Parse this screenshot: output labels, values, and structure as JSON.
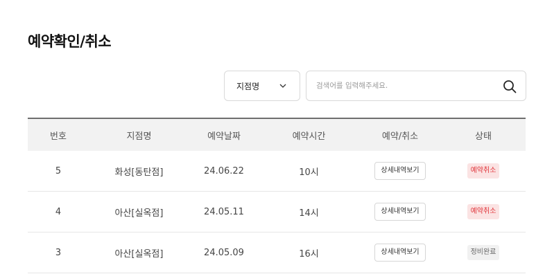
{
  "page": {
    "title": "예약확인/취소"
  },
  "filter": {
    "branch_select_value": "지점명",
    "search_placeholder": "검색어를 입력해주세요."
  },
  "table": {
    "headers": [
      "번호",
      "지점명",
      "예약날짜",
      "예약시간",
      "예약/취소",
      "상태"
    ],
    "rows": [
      {
        "no": "5",
        "branch": "화성[동탄점]",
        "date": "24.06.22",
        "time": "10시",
        "action": "상세내역보기",
        "status": "예약취소",
        "status_type": "cancel"
      },
      {
        "no": "4",
        "branch": "아산[실옥점]",
        "date": "24.05.11",
        "time": "14시",
        "action": "상세내역보기",
        "status": "예약취소",
        "status_type": "cancel"
      },
      {
        "no": "3",
        "branch": "아산[실옥점]",
        "date": "24.05.09",
        "time": "16시",
        "action": "상세내역보기",
        "status": "정비완료",
        "status_type": "done"
      }
    ]
  },
  "colors": {
    "cancel_badge_bg": "#fbe3e3",
    "cancel_badge_text": "#e0353b",
    "done_badge_bg": "#f1f1f1",
    "header_bg": "#f2f2f2"
  }
}
